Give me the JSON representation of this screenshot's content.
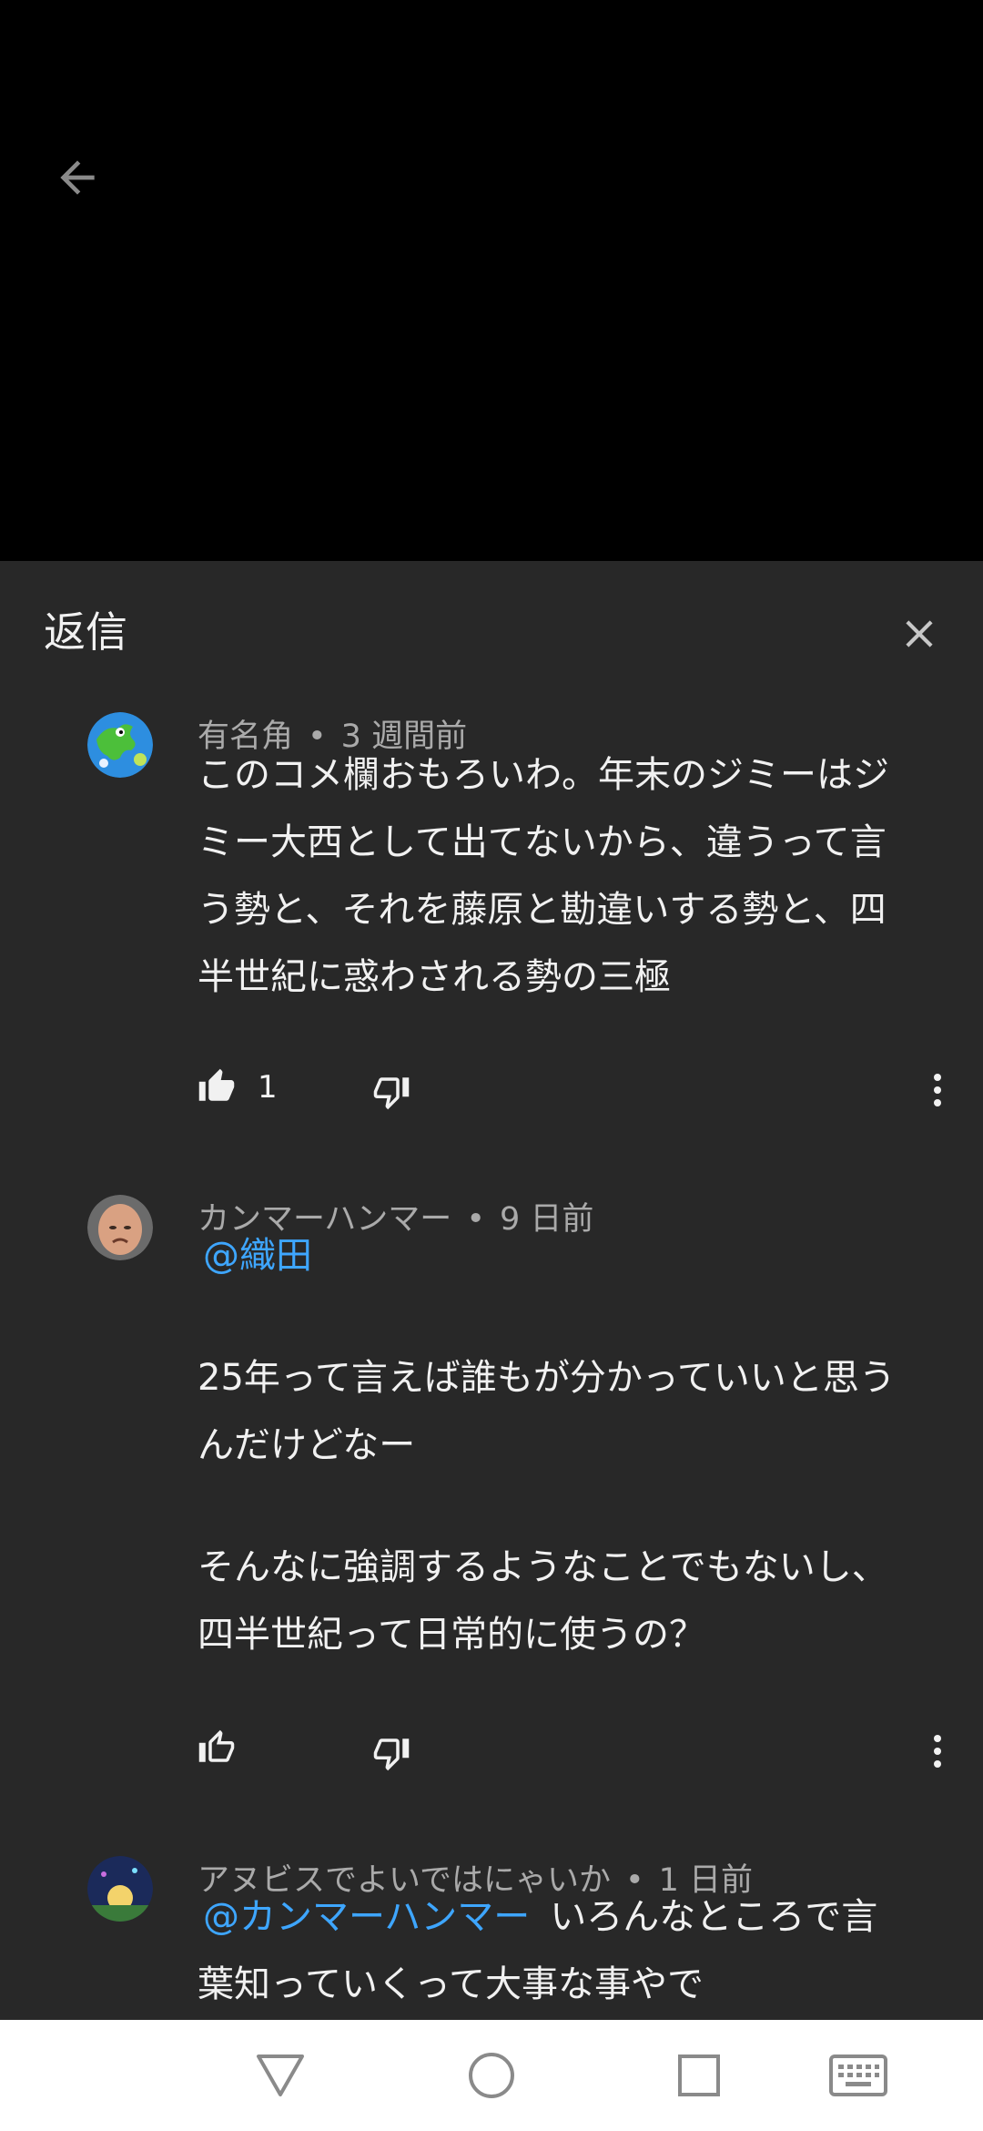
{
  "panel": {
    "title": "返信"
  },
  "comments": [
    {
      "author": "有名角",
      "time": "3 週間前",
      "text_lines": [
        "このコメ欄おもろいわ。年末のジミーはジ",
        "ミー大西として出てないから、違うって言",
        "う勢と、それを藤原と勘違いする勢と、四",
        "半世紀に惑わされる勢の三極"
      ],
      "likes": "1",
      "liked": true,
      "avatar_icon": "dinosaur-globe-avatar"
    },
    {
      "author": "カンマーハンマー",
      "time": "9 日前",
      "mention": "@織田",
      "text_lines": [
        "25年って言えば誰もが分かっていいと思う",
        "んだけどなー",
        "",
        "そんなに強調するようなことでもないし、",
        "四半世紀って日常的に使うの？"
      ],
      "likes": "",
      "liked": false,
      "avatar_icon": "bald-man-avatar"
    },
    {
      "author": "アヌビスでよいではにゃいか",
      "time": "1 日前",
      "mention": "@カンマーハンマー",
      "text_inline": "いろんなところで言",
      "text_lines": [
        "葉知っていくって大事な事やで"
      ],
      "avatar_icon": "night-sky-avatar"
    }
  ],
  "colors": {
    "panel_bg": "#282828",
    "text_primary": "#f1f1f1",
    "text_secondary": "#aaaaaa",
    "mention": "#3ea6ff"
  },
  "icons": [
    "back-arrow-icon",
    "close-icon",
    "thumbs-up-icon",
    "thumbs-down-icon",
    "more-vert-icon",
    "nav-back-icon",
    "nav-home-icon",
    "nav-recents-icon",
    "keyboard-icon"
  ]
}
